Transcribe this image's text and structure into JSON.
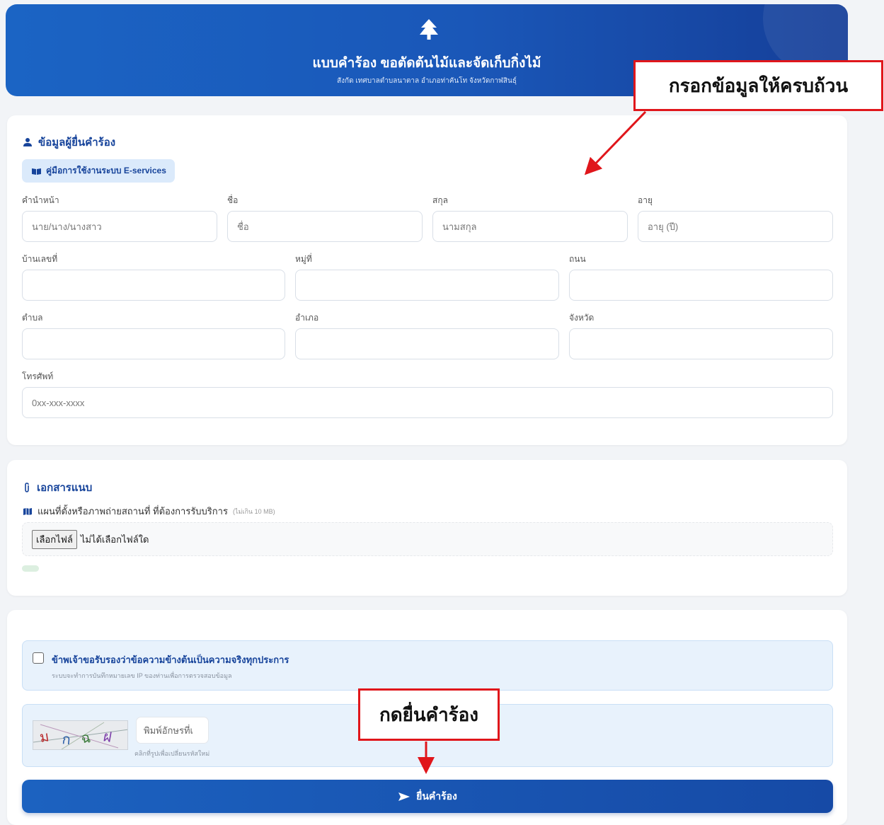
{
  "header": {
    "icon": "tree-icon",
    "title": "แบบคำร้อง ขอตัดต้นไม้และจัดเก็บกิ่งไม้",
    "subtitle": "สังกัด เทศบาลตำบลนาตาล อำเภอท่าคันโท จังหวัดกาฬสินธุ์"
  },
  "applicant": {
    "section_title": "ข้อมูลผู้ยื่นคำร้อง",
    "manual_button": "คู่มือการใช้งานระบบ E-services",
    "fields": {
      "prefix": {
        "label": "คำนำหน้า",
        "placeholder": "นาย/นาง/นางสาว"
      },
      "first_name": {
        "label": "ชื่อ",
        "placeholder": "ชื่อ"
      },
      "last_name": {
        "label": "สกุล",
        "placeholder": "นามสกุล"
      },
      "age": {
        "label": "อายุ",
        "placeholder": "อายุ (ปี)"
      },
      "house_no": {
        "label": "บ้านเลขที่",
        "placeholder": ""
      },
      "moo": {
        "label": "หมู่ที่",
        "placeholder": ""
      },
      "road": {
        "label": "ถนน",
        "placeholder": ""
      },
      "subdistrict": {
        "label": "ตำบล",
        "placeholder": ""
      },
      "district": {
        "label": "อำเภอ",
        "placeholder": ""
      },
      "province": {
        "label": "จังหวัด",
        "placeholder": ""
      },
      "phone": {
        "label": "โทรศัพท์",
        "placeholder": "0xx-xxx-xxxx"
      }
    }
  },
  "attachments": {
    "section_title": "เอกสารแนบ",
    "map_label": "แผนที่ตั้งหรือภาพถ่ายสถานที่ ที่ต้องการรับบริการ",
    "size_note": "(ไม่เกิน 10 MB)",
    "file_button": "เลือกไฟล์",
    "file_status": "ไม่ได้เลือกไฟล์ใด"
  },
  "confirm": {
    "checkbox_label": "ข้าพเจ้าขอรับรองว่าข้อความข้างต้นเป็นความจริงทุกประการ",
    "ip_note": "ระบบจะทำการบันทึกหมายเลข IP ของท่านเพื่อการตรวจสอบข้อมูล",
    "checked": false
  },
  "captcha": {
    "chars": [
      "ม",
      "ก",
      "ฉ",
      "ฝ"
    ],
    "char_colors": [
      "#b8282a",
      "#2d5fa8",
      "#3a7a3a",
      "#7a3aa8"
    ],
    "input_placeholder": "พิมพ์อักษรที่เ",
    "hint": "คลิกที่รูปเพื่อเปลี่ยนรหัสใหม่"
  },
  "submit": {
    "label": "ยื่นคำร้อง",
    "icon": "send-icon"
  },
  "annotations": {
    "top_callout": "กรอกข้อมูลให้ครบถ้วน",
    "bottom_callout": "กดยื่นคำร้อง",
    "color": "#e0161b"
  }
}
